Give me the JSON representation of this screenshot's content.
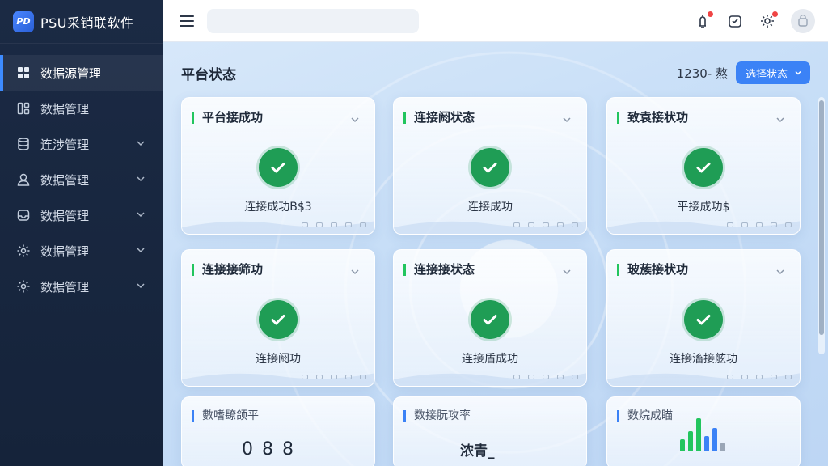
{
  "app": {
    "name": "PSU采销联软件",
    "logo_text": "PSU"
  },
  "sidebar": {
    "items": [
      {
        "label": "数据源管理",
        "icon": "grid-icon",
        "active": true
      },
      {
        "label": "数据管理",
        "icon": "layout-icon"
      },
      {
        "label": "连涉管理",
        "icon": "database-icon",
        "expandable": true
      },
      {
        "label": "数据管理",
        "icon": "user-icon",
        "expandable": true
      },
      {
        "label": "数据管理",
        "icon": "inbox-icon",
        "expandable": true
      },
      {
        "label": "数据管理",
        "icon": "gear-icon",
        "expandable": true
      },
      {
        "label": "数据管理",
        "icon": "gear-icon",
        "expandable": true
      }
    ]
  },
  "header": {
    "search_placeholder": "",
    "icons": [
      "notification-icon",
      "message-icon",
      "settings-icon",
      "avatar"
    ]
  },
  "section": {
    "title": "平台状态",
    "meta": "1230- 熬",
    "status_button": "选择状态"
  },
  "cards": [
    {
      "title": "平台接成功",
      "text": "连接成功B$3"
    },
    {
      "title": "连接阏状态",
      "text": "连接成功"
    },
    {
      "title": "致袁接状功",
      "text": "平接成功$"
    },
    {
      "title": "连接接筛功",
      "text": "连接阏功"
    },
    {
      "title": "连接接状态",
      "text": "连接盾成功"
    },
    {
      "title": "玻蔟接状功",
      "text": "连接滀接舷功"
    }
  ],
  "bottom_cards": [
    {
      "title": "數嗜镽颌平",
      "value": "0 8 8"
    },
    {
      "title": "数接朊攻率",
      "value": "浓青_"
    },
    {
      "title": "数烷成瞄",
      "value": ""
    }
  ],
  "colors": {
    "accent": "#3b82f6",
    "success": "#1f9d55",
    "sidebar": "#1b2a44"
  }
}
